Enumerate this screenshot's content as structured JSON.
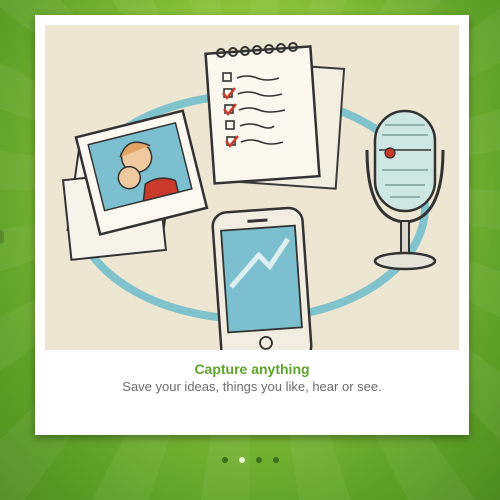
{
  "slide": {
    "title": "Capture anything",
    "subtitle": "Save your ideas, things you like, hear or see.",
    "illustration_items": [
      "checklist-icon",
      "photos-icon",
      "microphone-icon",
      "smartphone-icon"
    ]
  },
  "pager": {
    "count": 4,
    "active_index": 1
  },
  "colors": {
    "accent": "#5fa32c",
    "teal": "#6fbccb",
    "check_red": "#c93a2c",
    "paper": "#ece6d2"
  }
}
